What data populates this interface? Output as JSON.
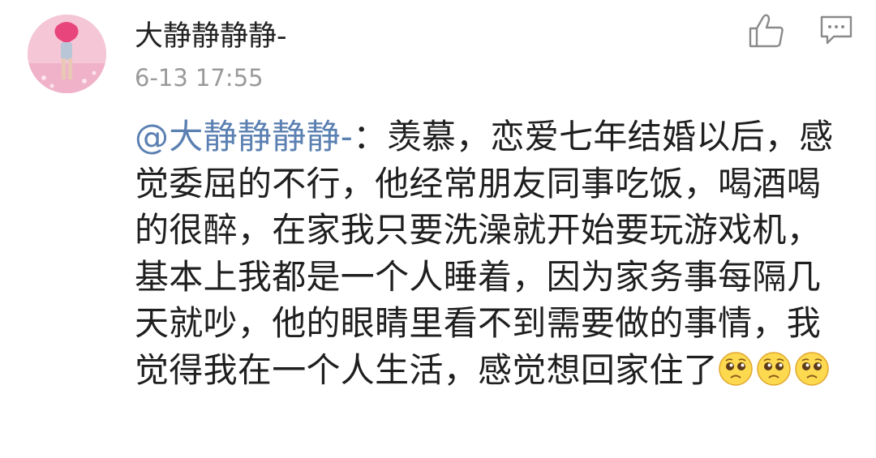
{
  "comment": {
    "author": "大静静静静-",
    "time": "6-13 17:55",
    "mention": "@大静静静静-",
    "text": "：羡慕，恋爱七年结婚以后，感觉委屈的不行，他经常朋友同事吃饭，喝酒喝的很醉，在家我只要洗澡就开始要玩游戏机，基本上我都是一个人睡着，因为家务事每隔几天就吵，他的眼睛里看不到需要做的事情，我觉得我在一个人生活，感觉想回家住了",
    "emojis": [
      "teary-eyed-emoji",
      "teary-eyed-emoji",
      "teary-eyed-emoji"
    ]
  },
  "icons": {
    "like": "thumbs-up-icon",
    "reply": "comment-bubble-icon"
  },
  "colors": {
    "mention": "#5b80b2",
    "timestamp": "#9a9a9a",
    "text": "#1f1f1f"
  }
}
